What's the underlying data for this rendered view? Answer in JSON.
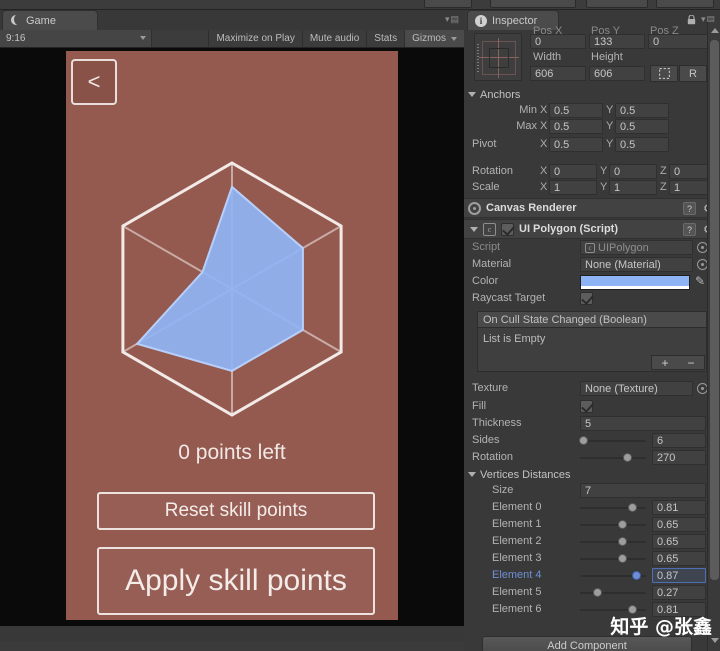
{
  "game_panel": {
    "tab_label": "Game",
    "tab_icon": "unity-game-icon",
    "toolbar": {
      "aspect_value": "9:16",
      "maximize_on_play": "Maximize on Play",
      "mute_audio": "Mute audio",
      "stats": "Stats",
      "gizmos": "Gizmos"
    },
    "screen": {
      "background_color": "#94594f",
      "back_button_label": "<",
      "points_left_text": "0 points left",
      "reset_button_label": "Reset skill points",
      "apply_button_label": "Apply skill points",
      "radar": {
        "outline_color": "#f2eae7",
        "spoke_color": "#c9aba5",
        "fill_color": "#8fb4f5",
        "fill_stroke_color": "#b7d0fb",
        "sides": 6,
        "values": [
          0.81,
          0.65,
          0.65,
          0.65,
          0.87,
          0.27,
          0.81
        ]
      }
    }
  },
  "inspector": {
    "tab_label": "Inspector",
    "tab_icon": "info-icon",
    "lock_icon": "lock-icon",
    "menu_icon": "kebab-menu-icon",
    "rect_transform": {
      "pos_labels": [
        "Pos X",
        "Pos Y",
        "Pos Z"
      ],
      "pos_values": [
        "0",
        "133",
        "0"
      ],
      "width_label": "Width",
      "height_label": "Height",
      "width_value": "606",
      "height_value": "606",
      "blueprint_button": "blueprint-icon",
      "raw_button_label": "R",
      "anchors_label": "Anchors",
      "min_label": "Min",
      "max_label": "Max",
      "pivot_label": "Pivot",
      "anchor_min": {
        "x": "0.5",
        "y": "0.5"
      },
      "anchor_max": {
        "x": "0.5",
        "y": "0.5"
      },
      "pivot": {
        "x": "0.5",
        "y": "0.5"
      },
      "rotation_label": "Rotation",
      "rotation": {
        "x": "0",
        "y": "0",
        "z": "0"
      },
      "scale_label": "Scale",
      "scale": {
        "x": "1",
        "y": "1",
        "z": "1"
      },
      "axis_x": "X",
      "axis_y": "Y",
      "axis_z": "Z"
    },
    "canvas_renderer": {
      "title": "Canvas Renderer",
      "icon": "canvas-renderer-icon",
      "help_icon": "help-icon",
      "gear_icon": "gear-icon"
    },
    "ui_polygon": {
      "title": "UI Polygon (Script)",
      "icon": "script-icon",
      "enabled": true,
      "help_icon": "help-icon",
      "gear_icon": "gear-icon",
      "script_label": "Script",
      "script_value": "UIPolygon",
      "material_label": "Material",
      "material_value": "None (Material)",
      "color_label": "Color",
      "color_value": "#8fb4f5",
      "eyedropper_icon": "eyedropper-icon",
      "raycast_label": "Raycast Target",
      "raycast_checked": true,
      "event_title": "On Cull State Changed (Boolean)",
      "event_empty": "List is Empty",
      "event_add": "+",
      "event_remove": "−",
      "texture_label": "Texture",
      "texture_value": "None (Texture)",
      "fill_label": "Fill",
      "fill_checked": true,
      "thickness_label": "Thickness",
      "thickness_value": "5",
      "sides_label": "Sides",
      "sides_value": "6",
      "sides_slider_pct": 6,
      "rotation_label": "Rotation",
      "rotation_value": "270",
      "rotation_slider_pct": 73,
      "vertices_label": "Vertices Distances",
      "size_label": "Size",
      "size_value": "7",
      "elements": [
        {
          "label": "Element 0",
          "value": "0.81",
          "pct": 81,
          "selected": false
        },
        {
          "label": "Element 1",
          "value": "0.65",
          "pct": 65,
          "selected": false
        },
        {
          "label": "Element 2",
          "value": "0.65",
          "pct": 65,
          "selected": false
        },
        {
          "label": "Element 3",
          "value": "0.65",
          "pct": 65,
          "selected": false
        },
        {
          "label": "Element 4",
          "value": "0.87",
          "pct": 87,
          "selected": true
        },
        {
          "label": "Element 5",
          "value": "0.27",
          "pct": 27,
          "selected": false
        },
        {
          "label": "Element 6",
          "value": "0.81",
          "pct": 81,
          "selected": false
        }
      ]
    },
    "add_component_label": "Add Component"
  },
  "watermark": "知乎 @张鑫"
}
